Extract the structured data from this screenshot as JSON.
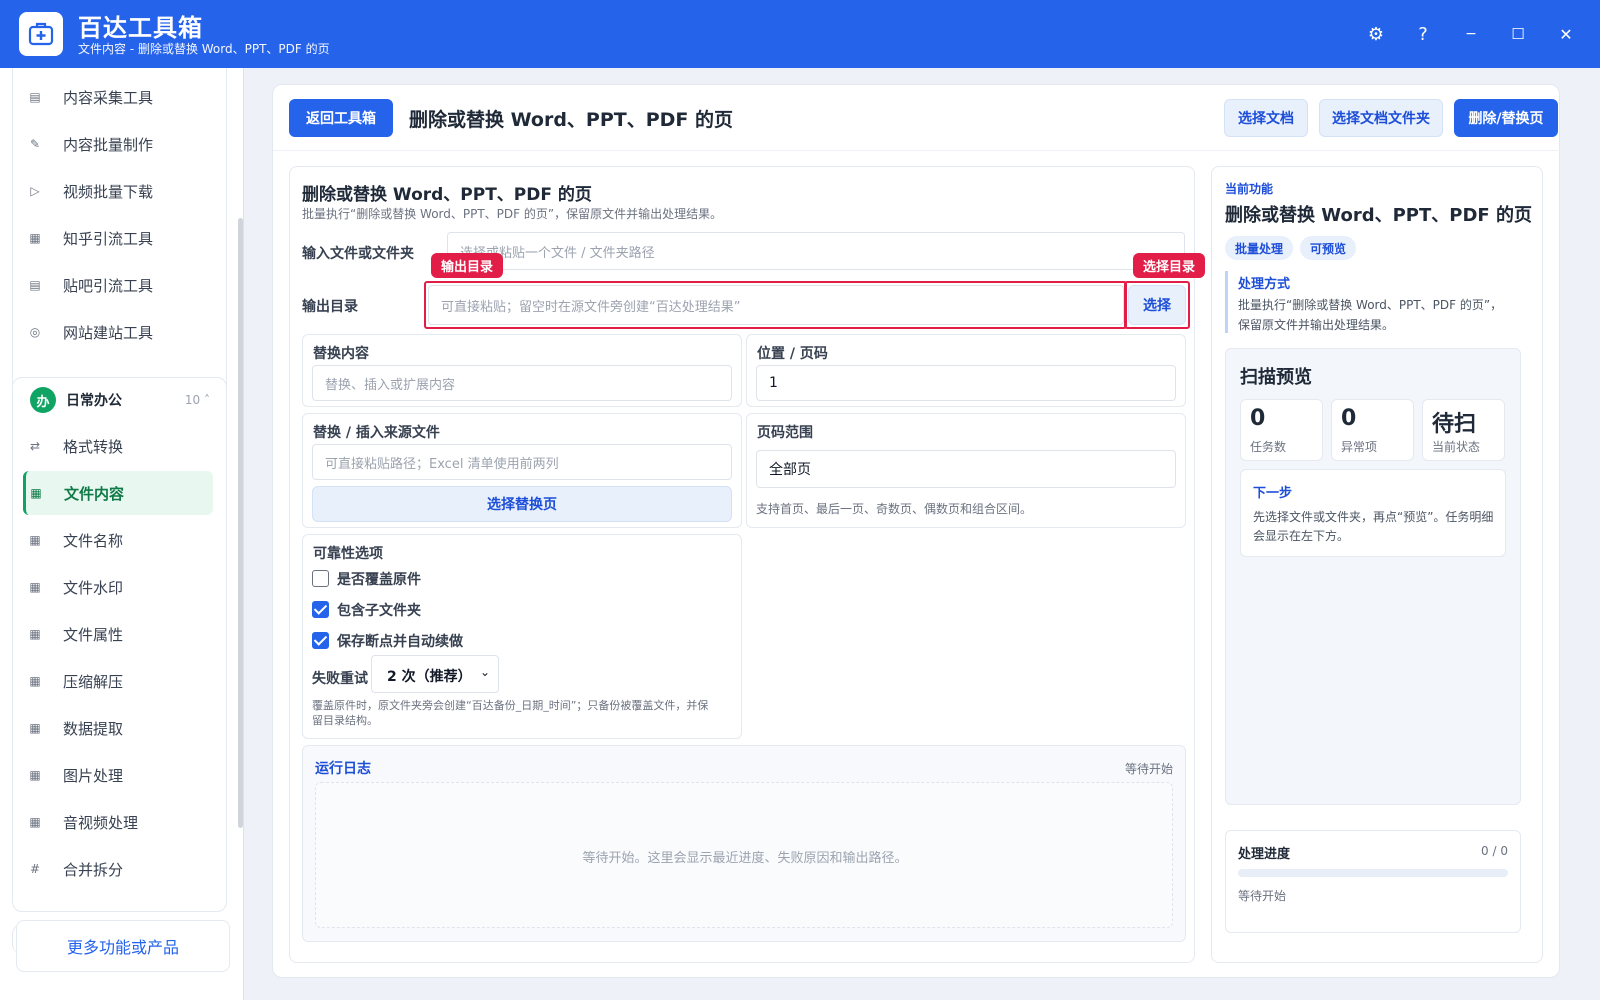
{
  "app": {
    "title": "百达工具箱",
    "subtitle": "文件内容 - 删除或替换 Word、PPT、PDF 的页"
  },
  "window_controls": {
    "settings": "⚙",
    "help": "?",
    "minimize": "−",
    "maximize": "☐",
    "close": "✕"
  },
  "sidebar": {
    "top_items": [
      {
        "icon": "▤",
        "label": "内容采集工具"
      },
      {
        "icon": "✎",
        "label": "内容批量制作"
      },
      {
        "icon": "▷",
        "label": "视频批量下载"
      },
      {
        "icon": "▦",
        "label": "知乎引流工具"
      },
      {
        "icon": "▤",
        "label": "贴吧引流工具"
      },
      {
        "icon": "◎",
        "label": "网站建站工具"
      }
    ],
    "group": {
      "icon_text": "办",
      "label": "日常办公",
      "count": "10 ˄"
    },
    "items": [
      {
        "icon": "⇄",
        "label": "格式转换"
      },
      {
        "icon": "▦",
        "label": "文件内容"
      },
      {
        "icon": "▦",
        "label": "文件名称"
      },
      {
        "icon": "▦",
        "label": "文件水印"
      },
      {
        "icon": "▦",
        "label": "文件属性"
      },
      {
        "icon": "▦",
        "label": "压缩解压"
      },
      {
        "icon": "▦",
        "label": "数据提取"
      },
      {
        "icon": "▦",
        "label": "图片处理"
      },
      {
        "icon": "▦",
        "label": "音视频处理"
      },
      {
        "icon": "#",
        "label": "合并拆分"
      }
    ],
    "more_label": "更多功能或产品"
  },
  "toolbar": {
    "back_label": "返回工具箱",
    "page_title": "删除或替换 Word、PPT、PDF 的页",
    "select_doc": "选择文档",
    "select_folder": "选择文档文件夹",
    "run": "删除/替换页"
  },
  "form": {
    "title": "删除或替换 Word、PPT、PDF 的页",
    "desc": "批量执行“删除或替换 Word、PPT、PDF 的页”，保留原文件并输出处理结果。",
    "input_label": "输入文件或文件夹",
    "input_placeholder": "选择或粘贴一个文件 / 文件夹路径",
    "output_label": "输出目录",
    "output_placeholder": "可直接粘贴；留空时在源文件旁创建“百达处理结果”",
    "output_btn": "选择",
    "tag_output": "输出目录",
    "tag_select": "选择目录",
    "replace_title": "替换内容",
    "replace_placeholder": "替换、插入或扩展内容",
    "position_title": "位置 / 页码",
    "position_value": "1",
    "source_title": "替换 / 插入来源文件",
    "source_placeholder": "可直接粘贴路径；Excel 清单使用前两列",
    "source_btn": "选择替换页",
    "range_title": "页码范围",
    "range_value": "全部页",
    "range_hint": "支持首页、最后一页、奇数页、偶数页和组合区间。",
    "reliability_title": "可靠性选项",
    "opt_overwrite": "是否覆盖原件",
    "opt_subfolders": "包含子文件夹",
    "opt_resume": "保存断点并自动续做",
    "retry_label": "失败重试",
    "retry_value": "2 次（推荐）",
    "note_line1": "覆盖原件时，原文件夹旁会创建“百达备份_日期_时间”；只备份被覆盖文件，并保",
    "note_line2": "留目录结构。",
    "log_title": "运行日志",
    "log_status": "等待开始",
    "log_empty": "等待开始。这里会显示最近进度、失败原因和输出路径。"
  },
  "panel": {
    "current_label": "当前功能",
    "title": "删除或替换 Word、PPT、PDF 的页",
    "tags": [
      "批量处理",
      "可预览"
    ],
    "method_title": "处理方式",
    "method_line1": "批量执行“删除或替换 Word、PPT、PDF 的页”，",
    "method_line2": "保留原文件并输出处理结果。",
    "preview_title": "扫描预览",
    "stats": [
      {
        "value": "0",
        "label": "任务数"
      },
      {
        "value": "0",
        "label": "异常项"
      },
      {
        "value": "待扫",
        "label": "当前状态"
      }
    ],
    "next_title": "下一步",
    "next_line1": "先选择文件或文件夹，再点“预览”。任务明细",
    "next_line2": "会显示在左下方。",
    "progress_title": "处理进度",
    "progress_count": "0 / 0",
    "progress": 0,
    "progress_status": "等待开始"
  },
  "colors": {
    "primary": "#2563eb",
    "accent": "#10a464",
    "highlight": "#e11d48"
  }
}
